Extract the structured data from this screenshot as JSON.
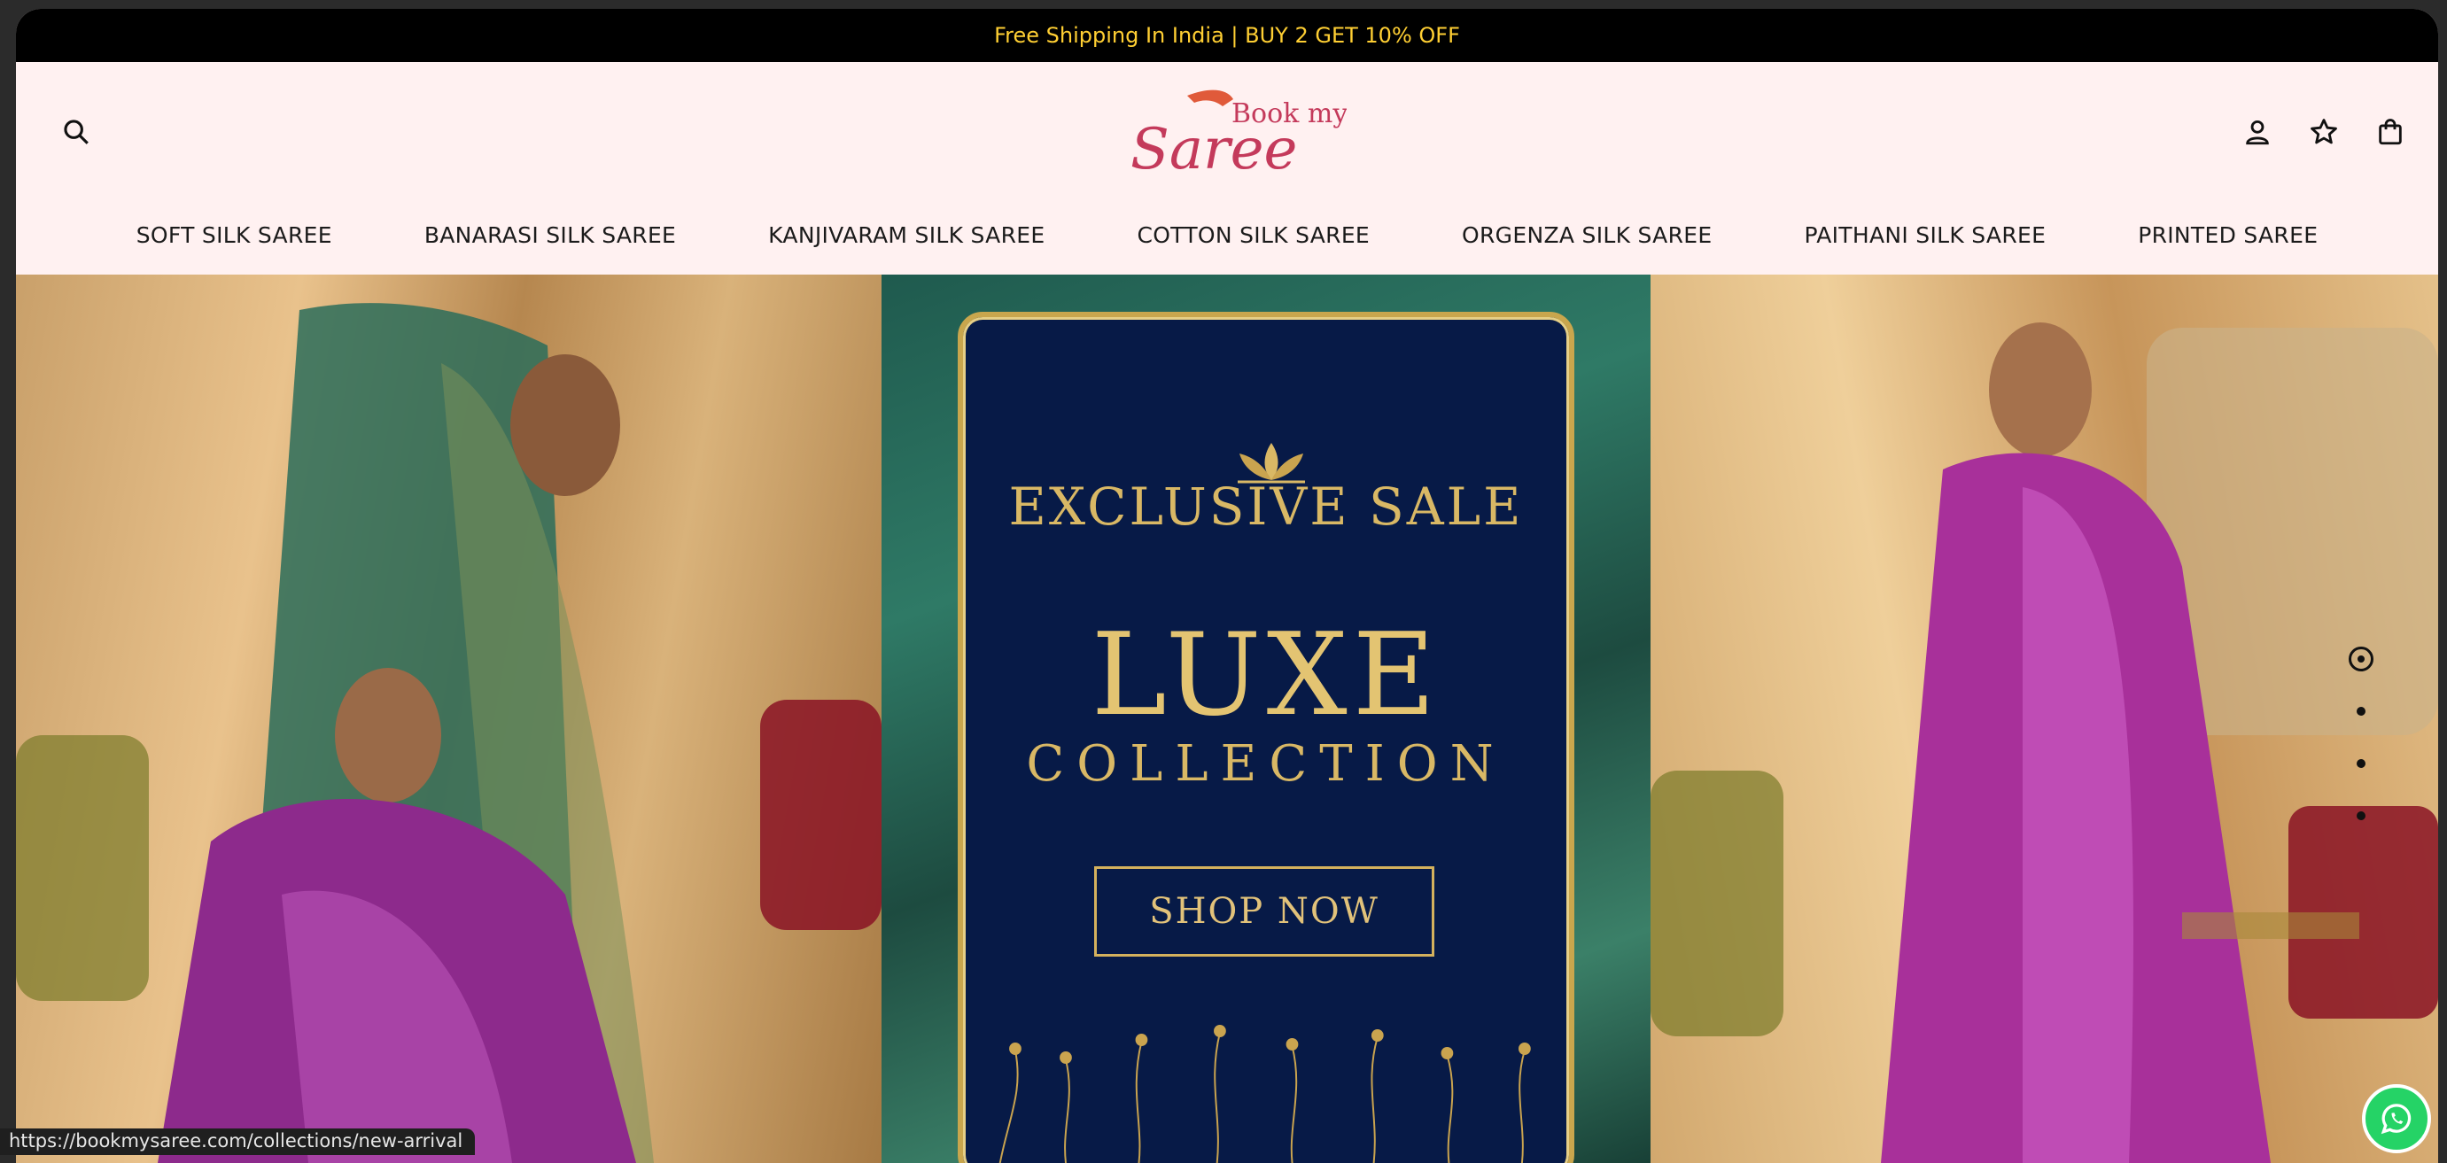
{
  "announcement": {
    "text": "Free Shipping In India | BUY 2 GET 10% OFF"
  },
  "brand": {
    "logo_alt": "Book my Saree",
    "logo_line1": "Book my",
    "logo_line2": "Saree",
    "color_primary": "#c43a5b",
    "color_accent": "#e05a3a"
  },
  "header_icons": {
    "search": "search-icon",
    "account": "user-icon",
    "wishlist": "star-icon",
    "cart": "bag-icon"
  },
  "nav": {
    "items": [
      "SOFT SILK SAREE",
      "BANARASI SILK SAREE",
      "KANJIVARAM SILK SAREE",
      "COTTON SILK SAREE",
      "ORGENZA SILK SAREE",
      "PAITHANI SILK SAREE",
      "PRINTED SAREE"
    ]
  },
  "hero": {
    "line1": "EXCLUSIVE SALE",
    "line2": "LUXE",
    "line3": "COLLECTION",
    "cta": "SHOP NOW",
    "card_color": "#071a47",
    "gold_color": "#d9b865"
  },
  "slider": {
    "total_slides": 4,
    "active_slide": 1
  },
  "status_bar": {
    "url": "https://bookmysaree.com/collections/new-arrival"
  },
  "colors": {
    "topbar_bg": "#000000",
    "topbar_text": "#ffcf33",
    "header_bg": "#fff1f1",
    "whatsapp": "#25d366"
  }
}
